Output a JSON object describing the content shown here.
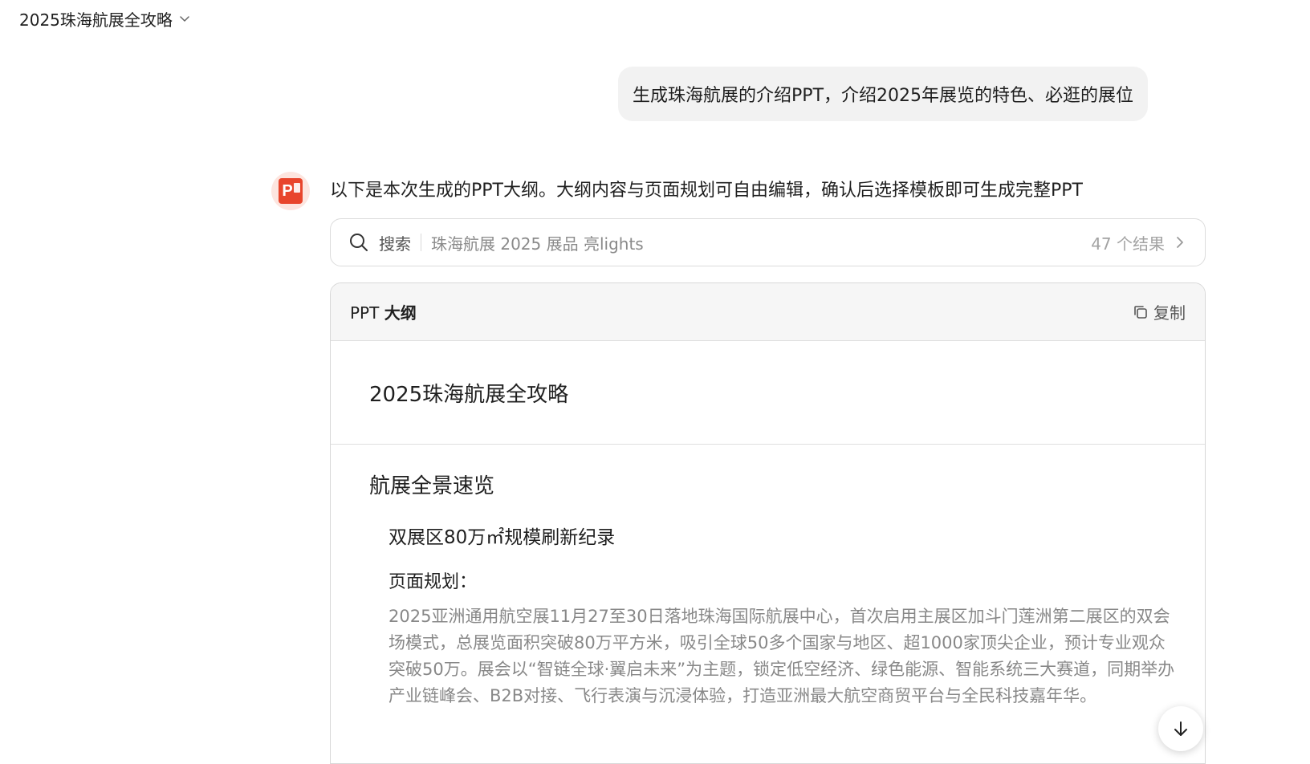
{
  "header": {
    "title": "2025珠海航展全攻略",
    "dropdown_icon": "chevron-down-icon"
  },
  "user_message": {
    "text": "生成珠海航展的介绍PPT，介绍2025年展览的特色、必逛的展位"
  },
  "assistant": {
    "avatar_icon": "ppt-icon",
    "avatar_letter": "P",
    "intro": "以下是本次生成的PPT大纲。大纲内容与页面规划可自由编辑，确认后选择模板即可生成完整PPT"
  },
  "search": {
    "icon": "search-icon",
    "label": "搜索",
    "query": "珠海航展 2025 展品 亮lights",
    "result_count": "47 个结果",
    "arrow_icon": "chevron-right-icon"
  },
  "outline": {
    "header_prefix": "PPT ",
    "header_bold": "大纲",
    "copy_label": "复制",
    "copy_icon": "copy-icon",
    "doc_title": "2025珠海航展全攻略",
    "sections": [
      {
        "title": "航展全景速览",
        "subtitle": "双展区80万㎡规模刷新纪录",
        "plan_label": "页面规划：",
        "plan_text": "2025亚洲通用航空展11月27至30日落地珠海国际航展中心，首次启用主展区加斗门莲洲第二展区的双会场模式，总展览面积突破80万平方米，吸引全球50多个国家与地区、超1000家顶尖企业，预计专业观众突破50万。展会以“智链全球·翼启未来”为主题，锁定低空经济、绿色能源、智能系统三大赛道，同期举办产业链峰会、B2B对接、飞行表演与沉浸体验，打造亚洲最大航空商贸平台与全民科技嘉年华。"
      }
    ]
  },
  "scroll_button": {
    "icon": "arrow-down-icon"
  },
  "colors": {
    "bubble_bg": "#f2f2f2",
    "card_header_bg": "#f6f6f6",
    "avatar_red": "#e8452c",
    "muted_text": "#888888"
  }
}
